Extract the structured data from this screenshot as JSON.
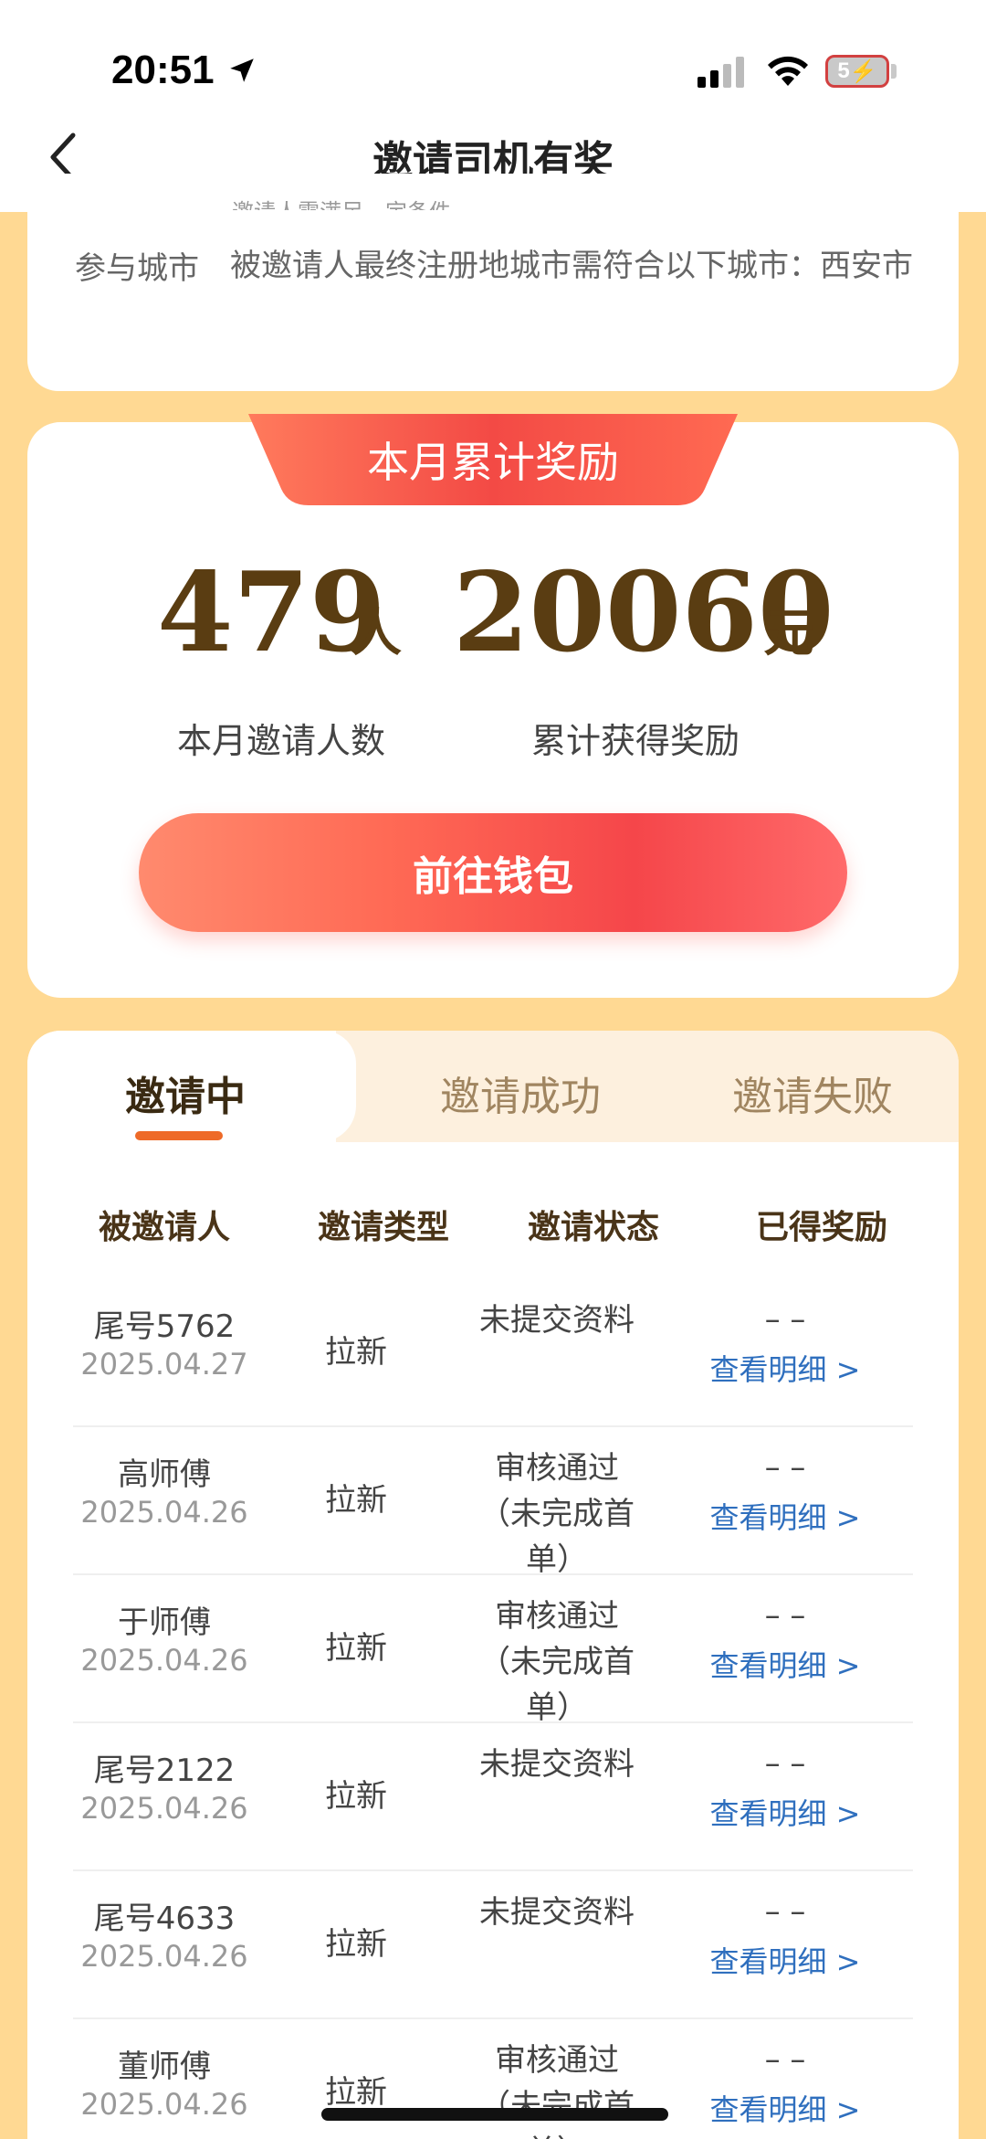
{
  "status_bar": {
    "time": "20:51",
    "battery": "5"
  },
  "nav": {
    "title": "邀请司机有奖"
  },
  "rules": {
    "clipped_line": "邀请人需满足一定条件",
    "city_label": "参与城市",
    "city_text": "被邀请人最终注册地城市需符合以下城市：西安市"
  },
  "reward": {
    "ribbon": "本月累计奖励",
    "invite_count": "479",
    "invite_unit": "人",
    "amount": "20060",
    "amount_unit": "元",
    "invite_label": "本月邀请人数",
    "amount_label": "累计获得奖励",
    "wallet_button": "前往钱包"
  },
  "tabs": [
    "邀请中",
    "邀请成功",
    "邀请失败"
  ],
  "table": {
    "headers": [
      "被邀请人",
      "邀请类型",
      "邀请状态",
      "已得奖励"
    ],
    "rows": [
      {
        "name": "尾号5762",
        "date": "2025.04.27",
        "type": "拉新",
        "status": "未提交资料",
        "reward": "– –",
        "link": "查看明细 >"
      },
      {
        "name": "高师傅",
        "date": "2025.04.26",
        "type": "拉新",
        "status": "审核通过（未完成首单）",
        "reward": "– –",
        "link": "查看明细 >"
      },
      {
        "name": "于师傅",
        "date": "2025.04.26",
        "type": "拉新",
        "status": "审核通过（未完成首单）",
        "reward": "– –",
        "link": "查看明细 >"
      },
      {
        "name": "尾号2122",
        "date": "2025.04.26",
        "type": "拉新",
        "status": "未提交资料",
        "reward": "– –",
        "link": "查看明细 >"
      },
      {
        "name": "尾号4633",
        "date": "2025.04.26",
        "type": "拉新",
        "status": "未提交资料",
        "reward": "– –",
        "link": "查看明细 >"
      },
      {
        "name": "董师傅",
        "date": "2025.04.26",
        "type": "拉新",
        "status": "审核通过（未完成首单）",
        "reward": "– –",
        "link": "查看明细 >"
      }
    ]
  },
  "colors": {
    "page_bg": "#ffd993",
    "accent_red": "#f5464a",
    "tab_underline": "#ee6a28",
    "number_brown": "#5a3d12",
    "link_blue": "#2f6fbe"
  }
}
